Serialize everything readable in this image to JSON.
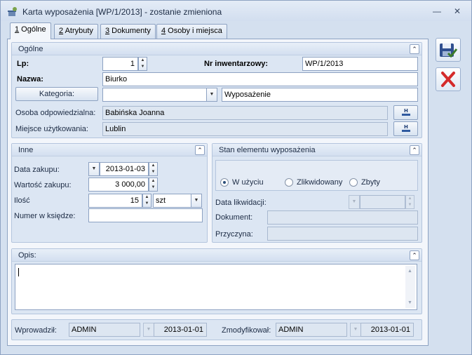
{
  "window": {
    "title": "Karta wyposażenia [WP/1/2013] - zostanie zmieniona",
    "minimize_glyph": "—",
    "close_glyph": "✕"
  },
  "tabs": [
    {
      "key": "1",
      "label": " Ogólne"
    },
    {
      "key": "2",
      "label": " Atrybuty"
    },
    {
      "key": "3",
      "label": " Dokumenty"
    },
    {
      "key": "4",
      "label": " Osoby i miejsca"
    }
  ],
  "general": {
    "section_title": "Ogólne",
    "lp_label": "Lp:",
    "lp_value": "1",
    "inv_label": "Nr inwentarzowy:",
    "inv_value": "WP/1/2013",
    "name_label": "Nazwa:",
    "name_value": "Biurko",
    "category_button": "Kategoria:",
    "category_code": "",
    "category_name": "Wyposażenie",
    "person_label": "Osoba odpowiedzialna:",
    "person_value": "Babińska Joanna",
    "place_label": "Miejsce użytkowania:",
    "place_value": "Lublin"
  },
  "other": {
    "section_title": "Inne",
    "purchase_date_label": "Data zakupu:",
    "purchase_date_value": "2013-01-03",
    "purchase_value_label": "Wartość zakupu:",
    "purchase_value_value": "3 000,00",
    "qty_label": "Ilość",
    "qty_value": "15",
    "unit_value": "szt",
    "book_no_label": "Numer w księdze:",
    "book_no_value": ""
  },
  "status": {
    "section_title": "Stan elementu wyposażenia",
    "options": [
      "W użyciu",
      "Zlikwidowany",
      "Zbyty"
    ],
    "selected": "W użyciu",
    "liquidation_date_label": "Data likwidacji:",
    "liquidation_date_value": "",
    "document_label": "Dokument:",
    "document_value": "",
    "reason_label": "Przyczyna:",
    "reason_value": ""
  },
  "description": {
    "section_title": "Opis:",
    "value": ""
  },
  "footer": {
    "entered_label": "Wprowadził:",
    "entered_user": "ADMIN",
    "entered_date": "2013-01-01",
    "modified_label": "Zmodyfikował:",
    "modified_user": "ADMIN",
    "modified_date": "2013-01-01"
  },
  "colors": {
    "window_bg": "#d4e0ef",
    "panel_bg": "#f3f6fb",
    "save_accent": "#3b7a2a",
    "cancel_accent": "#d42a2a"
  }
}
